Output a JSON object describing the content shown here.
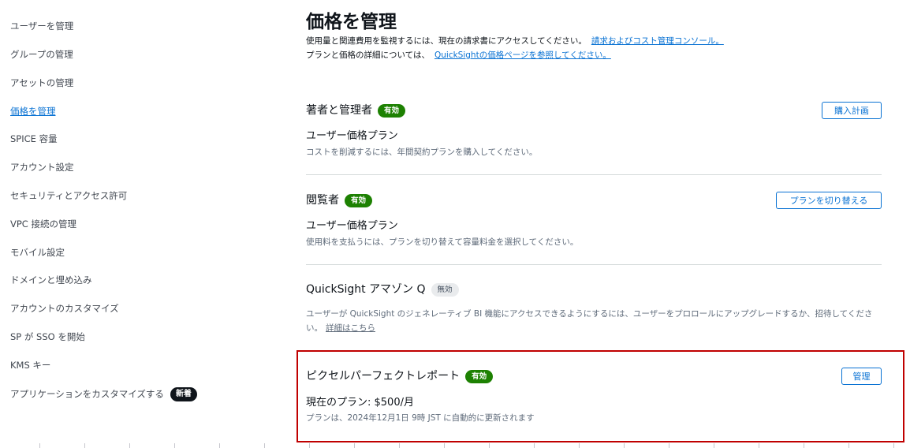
{
  "sidebar": {
    "items": [
      {
        "label": "ユーザーを管理"
      },
      {
        "label": "グループの管理"
      },
      {
        "label": "アセットの管理"
      },
      {
        "label": "価格を管理"
      },
      {
        "label": "SPICE 容量"
      },
      {
        "label": "アカウント設定"
      },
      {
        "label": "セキュリティとアクセス許可"
      },
      {
        "label": "VPC 接続の管理"
      },
      {
        "label": "モバイル設定"
      },
      {
        "label": "ドメインと埋め込み"
      },
      {
        "label": "アカウントのカスタマイズ"
      },
      {
        "label": "SP が SSO を開始"
      },
      {
        "label": "KMS キー"
      },
      {
        "label": "アプリケーションをカスタマイズする",
        "badge": "新着"
      }
    ],
    "active_item": "価格を管理"
  },
  "header": {
    "title": "価格を管理",
    "desc1": "使用量と関連費用を監視するには、現在の請求書にアクセスしてください。",
    "desc1_link": "請求およびコスト管理コンソール。",
    "desc2": "プランと価格の詳細については、",
    "desc2_link": "QuickSightの価格ページを参照してください。"
  },
  "sections": {
    "authors": {
      "title": "著者と管理者",
      "badge": "有効",
      "plan": "ユーザー価格プラン",
      "sub": "コストを削減するには、年間契約プランを購入してください。",
      "button": "購入計画"
    },
    "readers": {
      "title": "閲覧者",
      "badge": "有効",
      "plan": "ユーザー価格プラン",
      "sub": "使用料を支払うには、プランを切り替えて容量料金を選択してください。",
      "button": "プランを切り替える"
    },
    "q": {
      "title": "QuickSight アマゾン Q",
      "badge": "無効",
      "desc": "ユーザーが QuickSight のジェネレーティブ BI 機能にアクセスできるようにするには、ユーザーをプロロールにアップグレードするか、招待してください。",
      "link": "詳細はこちら"
    },
    "pixel": {
      "title": "ピクセルパーフェクトレポート",
      "badge": "有効",
      "plan": "現在のプラン: $500/月",
      "sub": "プランは、2024年12月1日 9時 JST に自動的に更新されます",
      "button": "管理"
    }
  },
  "colors": {
    "link": "#0972d3",
    "badge_enabled": "#1d8102",
    "badge_disabled": "#e9ebed",
    "highlight_border": "#c00000"
  }
}
